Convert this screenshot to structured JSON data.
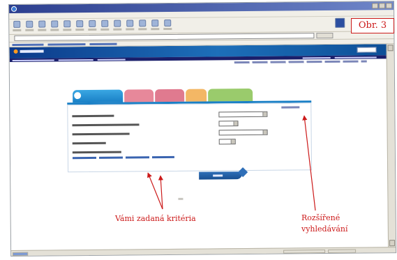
{
  "figure_label": "Obr. 3",
  "annotations": {
    "left": "Vámi zadaná kritéria",
    "right": "Rozšířené vyhledávání"
  },
  "colors": {
    "annotation_red": "#cc1a1a",
    "header_blue": "#1d6fb9",
    "tab_blue": "#1a80c6",
    "tab_pink": "#e7889a",
    "tab_orange": "#f3b765",
    "tab_green": "#9acb6c"
  },
  "icons": {
    "browser": "ie-icon",
    "toolbar": [
      "back-icon",
      "forward-icon",
      "stop-icon",
      "refresh-icon",
      "home-icon",
      "search-icon",
      "favorites-icon",
      "media-icon",
      "history-icon",
      "mail-icon",
      "print-icon",
      "edit-icon",
      "discuss-icon"
    ],
    "brand": "windows-logo-icon"
  }
}
